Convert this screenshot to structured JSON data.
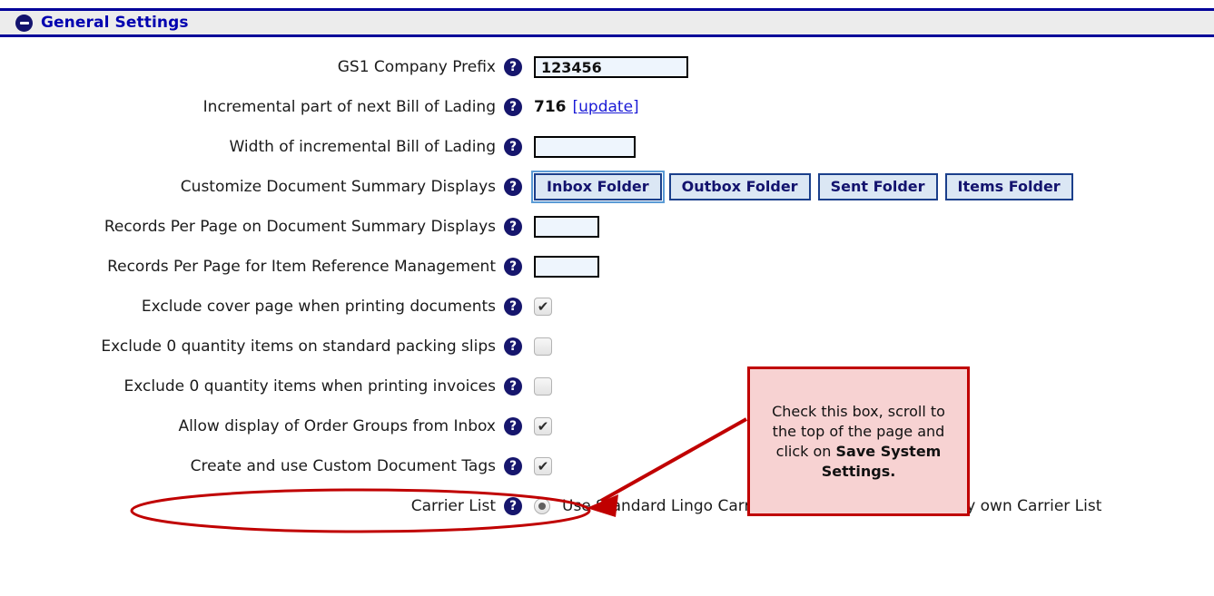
{
  "header": {
    "title": "General Settings",
    "collapse_icon": "minus-circle-icon"
  },
  "icons": {
    "help": "?",
    "check": "✔"
  },
  "form": {
    "rows": [
      {
        "label": "GS1 Company Prefix",
        "type": "text",
        "value": "123456"
      },
      {
        "label": "Incremental part of next Bill of Lading",
        "type": "static",
        "value": "716",
        "link": "[update]"
      },
      {
        "label": "Width of incremental Bill of Lading",
        "type": "text",
        "value": ""
      },
      {
        "label": "Customize Document Summary Displays",
        "type": "buttons",
        "buttons": [
          "Inbox Folder",
          "Outbox Folder",
          "Sent Folder",
          "Items Folder"
        ],
        "focused_button": "Inbox Folder"
      },
      {
        "label": "Records Per Page on Document Summary Displays",
        "type": "text",
        "value": ""
      },
      {
        "label": "Records Per Page for Item Reference Management",
        "type": "text",
        "value": ""
      },
      {
        "label": "Exclude cover page when printing documents",
        "type": "checkbox",
        "checked": true
      },
      {
        "label": "Exclude 0 quantity items on standard packing slips",
        "type": "checkbox",
        "checked": false
      },
      {
        "label": "Exclude 0 quantity items when printing invoices",
        "type": "checkbox",
        "checked": false
      },
      {
        "label": "Allow display of Order Groups from Inbox",
        "type": "checkbox",
        "checked": true
      },
      {
        "label": "Create and use Custom Document Tags",
        "type": "checkbox",
        "checked": true,
        "highlighted": true
      },
      {
        "label": "Carrier List",
        "type": "radio",
        "options": [
          {
            "label": "Use Standard Lingo Carrier List",
            "selected": true
          },
          {
            "label": "Define my own Carrier List",
            "selected": false
          }
        ]
      }
    ]
  },
  "annotation": {
    "callout_text_part1": "Check this box, scroll to the top of the page and click on ",
    "callout_text_bold": "Save System Settings.",
    "highlight_shape": "ellipse",
    "arrow": "arrow-pointing-to-checkbox"
  },
  "colors": {
    "panel_border": "#000099",
    "panel_bg": "#ececec",
    "title": "#0000b0",
    "help_icon": "#16166d",
    "input_bg": "#eef5fd",
    "button_bg": "#dbe7f4",
    "button_border": "#1b3f8b",
    "annotation_red": "#c00000",
    "callout_bg": "#f7d2d2",
    "link": "#1a1ad6"
  }
}
